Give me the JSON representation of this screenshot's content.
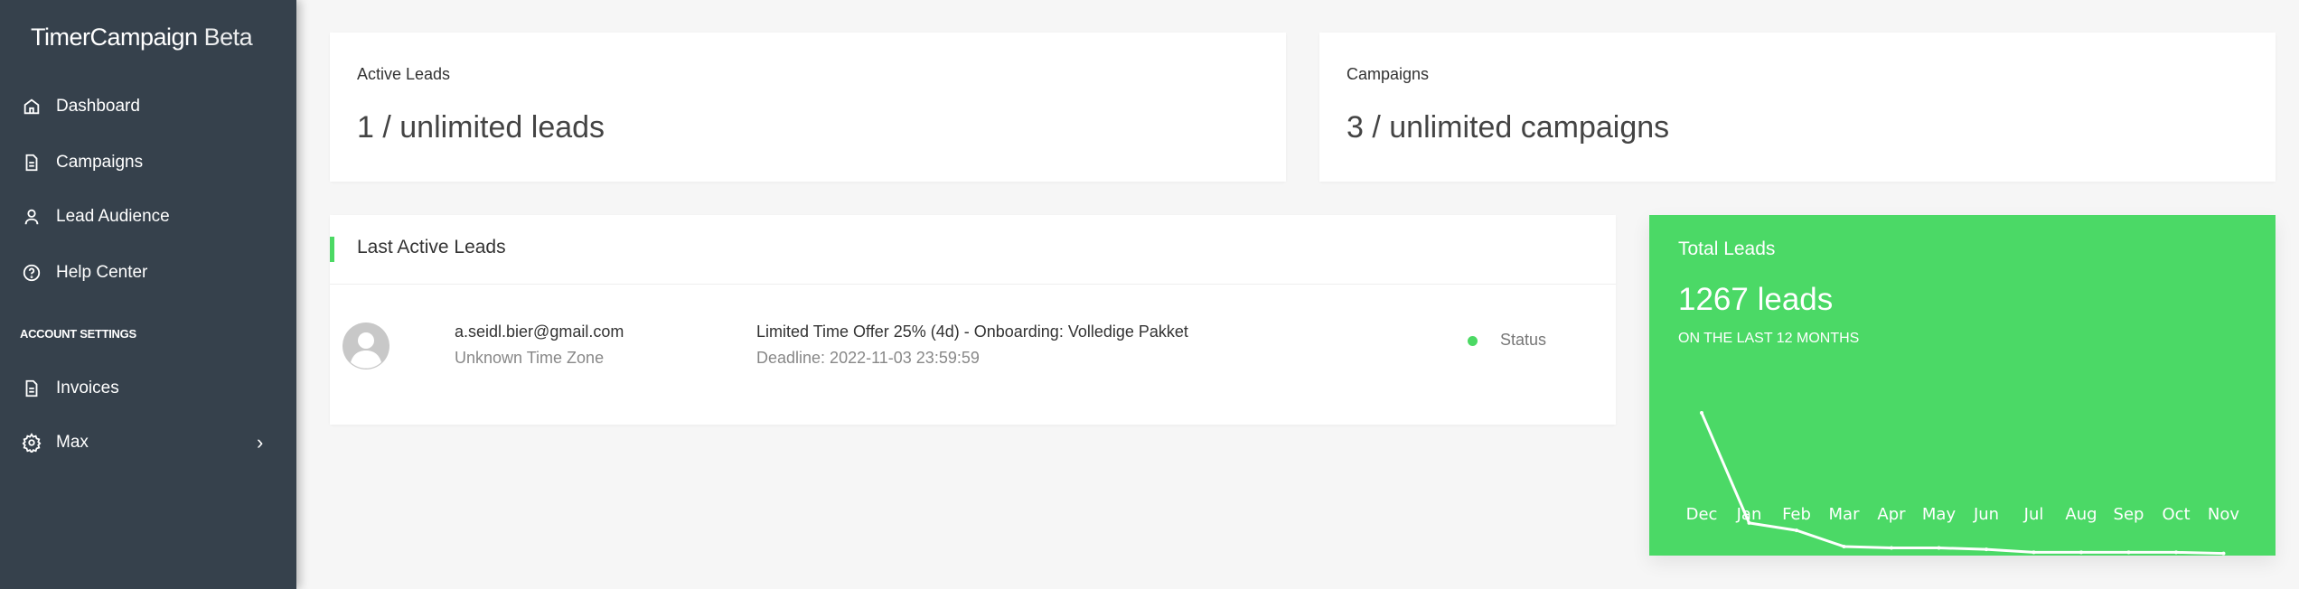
{
  "sidebar": {
    "brand": "TimerCampaign",
    "brand_suffix": "Beta",
    "items": [
      {
        "label": "Dashboard",
        "icon": "home-icon"
      },
      {
        "label": "Campaigns",
        "icon": "document-icon"
      },
      {
        "label": "Lead Audience",
        "icon": "user-icon"
      },
      {
        "label": "Help Center",
        "icon": "help-circle-icon"
      }
    ],
    "section": "ACCOUNT SETTINGS",
    "account_items": [
      {
        "label": "Invoices",
        "icon": "document-icon"
      },
      {
        "label": "Max",
        "icon": "gear-icon"
      }
    ]
  },
  "stats": {
    "active_leads": {
      "label": "Active Leads",
      "value": "1 / unlimited leads"
    },
    "campaigns": {
      "label": "Campaigns",
      "value": "3 / unlimited campaigns"
    }
  },
  "last_active": {
    "title": "Last Active Leads",
    "rows": [
      {
        "email": "a.seidl.bier@gmail.com",
        "timezone": "Unknown Time Zone",
        "campaign": "Limited Time Offer 25% (4d) - Onboarding: Volledige Pakket",
        "deadline": "Deadline: 2022-11-03 23:59:59",
        "status": "Status",
        "status_color": "#4cd964"
      }
    ]
  },
  "total_leads": {
    "title": "Total Leads",
    "value": "1267 leads",
    "subtitle": "ON THE LAST 12 MONTHS",
    "color": "#4bd966"
  },
  "chart_data": {
    "type": "line",
    "categories": [
      "Dec",
      "Jan",
      "Feb",
      "Mar",
      "Apr",
      "May",
      "Jun",
      "Jul",
      "Aug",
      "Sep",
      "Oct",
      "Nov"
    ],
    "values": [
      795,
      174,
      132,
      41,
      33,
      33,
      25,
      8,
      8,
      8,
      8,
      2
    ],
    "ylim": [
      0,
      795
    ],
    "grid": false
  }
}
